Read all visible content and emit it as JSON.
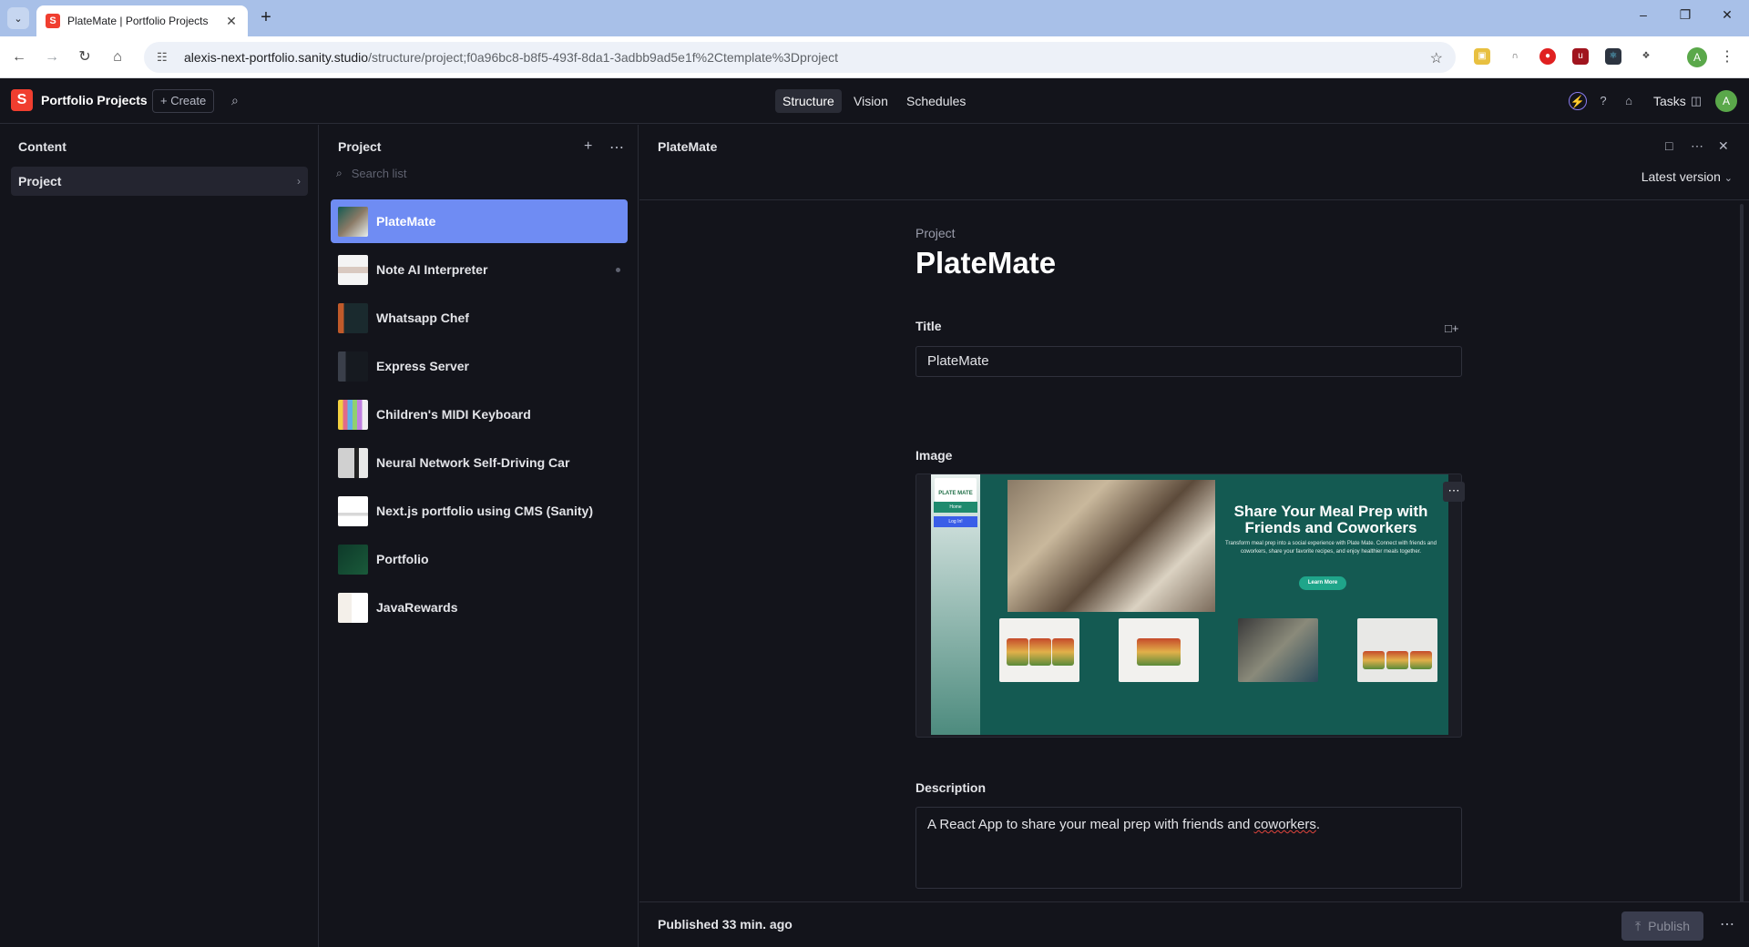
{
  "browser": {
    "tab_title": "PlateMate | Portfolio Projects",
    "tab_favicon": "S",
    "url_host": "alexis-next-portfolio.sanity.studio",
    "url_path": "/structure/project;f0a96bc8-b8f5-493f-8da1-3adbb9ad5e1f%2Ctemplate%3Dproject",
    "profile_initial": "A"
  },
  "studio": {
    "logo_letter": "S",
    "workspace": "Portfolio Projects",
    "create_label": "+ Create",
    "tabs": [
      {
        "label": "Structure",
        "active": true
      },
      {
        "label": "Vision",
        "active": false
      },
      {
        "label": "Schedules",
        "active": false
      }
    ],
    "tasks_label": "Tasks",
    "user_initial": "A",
    "accent_color": "#6f8cf3",
    "brand_color": "#f03e2f"
  },
  "content_pane": {
    "title": "Content",
    "items": [
      {
        "label": "Project"
      }
    ]
  },
  "project_pane": {
    "title": "Project",
    "search_placeholder": "Search list",
    "items": [
      {
        "label": "PlateMate",
        "selected": true
      },
      {
        "label": "Note AI Interpreter",
        "has_dot": true
      },
      {
        "label": "Whatsapp Chef"
      },
      {
        "label": "Express Server"
      },
      {
        "label": "Children's MIDI Keyboard"
      },
      {
        "label": "Neural Network Self-Driving Car"
      },
      {
        "label": "Next.js portfolio using CMS (Sanity)"
      },
      {
        "label": "Portfolio"
      },
      {
        "label": "JavaRewards"
      }
    ]
  },
  "document": {
    "header_title": "PlateMate",
    "version_label": "Latest version",
    "type_label": "Project",
    "big_title": "PlateMate",
    "title_field": {
      "label": "Title",
      "value": "PlateMate"
    },
    "image_field": {
      "label": "Image",
      "preview": {
        "logo_text": "PLATE MATE",
        "nav_home": "Home",
        "nav_login": "Log In!",
        "headline": "Share Your Meal Prep with Friends and Coworkers",
        "subtext": "Transform meal prep into a social experience with Plate Mate. Connect with friends and coworkers, share your favorite recipes, and enjoy healthier meals together.",
        "cta": "Learn More"
      }
    },
    "description_field": {
      "label": "Description",
      "value_before": "A React App to share your meal prep with friends and ",
      "value_misspelled": "coworkers",
      "value_after": "."
    },
    "footer": {
      "status": "Published 33 min. ago",
      "publish_label": "Publish"
    }
  }
}
